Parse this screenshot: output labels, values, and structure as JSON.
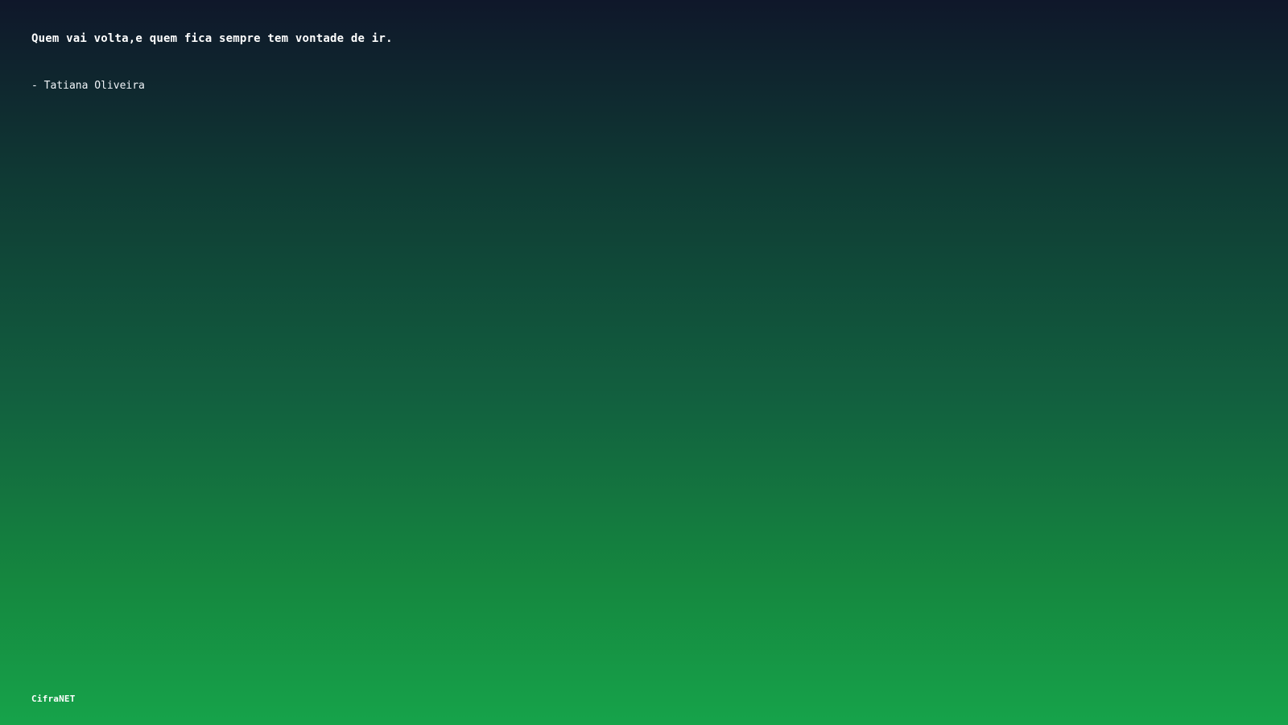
{
  "quote": {
    "text": "Quem vai volta,e quem fica sempre tem vontade de ir.",
    "author": "- Tatiana Oliveira"
  },
  "footer": {
    "brand": "CifraNET"
  },
  "colors": {
    "gradient_top": "#0f172a",
    "gradient_bottom": "#16a34a",
    "text": "#ffffff"
  }
}
